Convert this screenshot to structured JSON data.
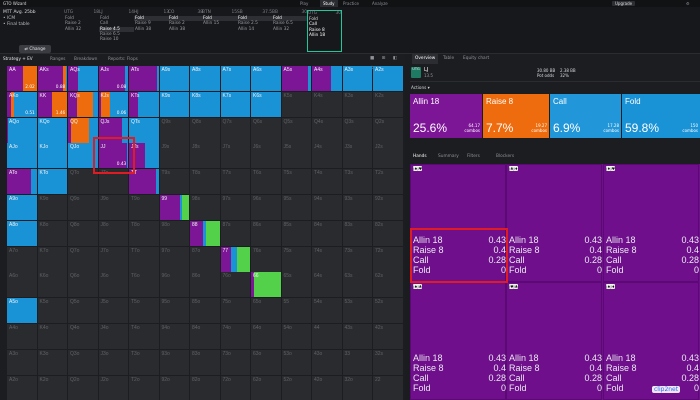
{
  "topnav": {
    "brand": "GTO Wizard",
    "items": [
      "Play",
      "Study",
      "Practice",
      "Analyze"
    ],
    "active": 1,
    "upgrade": "Upgrade"
  },
  "game": {
    "format": "MTT  Avg. 25bb",
    "line1": "ICM",
    "line2": "Final table",
    "change": "Change"
  },
  "positions": [
    {
      "name": "UTG",
      "stack": "18",
      "actions": [
        "Fold",
        "Raise 2",
        "Allin 32"
      ],
      "selected": -1
    },
    {
      "name": "LJ",
      "stack": "14",
      "actions": [
        "Fold",
        "Call",
        "Raise 4.5",
        "Raise 6.5",
        "Raise 10"
      ],
      "selected": 2
    },
    {
      "name": "HJ",
      "stack": "13",
      "actions": [
        "Fold",
        "Raise 9",
        "Allin 38"
      ],
      "selected": 0
    },
    {
      "name": "CO",
      "stack": "38",
      "actions": [
        "Fold",
        "Raise 2",
        "Allin 38"
      ],
      "selected": 0
    },
    {
      "name": "BTN",
      "stack": "15",
      "actions": [
        "Fold",
        "Allin 15"
      ],
      "selected": 0
    },
    {
      "name": "SB",
      "stack": "37.5",
      "actions": [
        "Fold",
        "Raise 2.5",
        "Allin 14"
      ],
      "selected": 0
    },
    {
      "name": "BB",
      "stack": "30",
      "actions": [
        "Fold",
        "Raise 6.5",
        "Allin 32"
      ],
      "selected": 0
    },
    {
      "name": "UTG",
      "stack": "30",
      "actions": [
        "Fold",
        "Call",
        "Raise 8",
        "Allin 18"
      ],
      "selected": -1,
      "current": true
    }
  ],
  "left_tabs": [
    "Strategy + EV",
    "Ranges",
    "Breakdown",
    "Reports: Flops"
  ],
  "left_tab_icons": "■ ⊞ ◧ ⚙",
  "right_tabs": [
    "Overview",
    "Table",
    "Equity chart"
  ],
  "summary": {
    "badge": "UTG",
    "label": "LJ",
    "sub": "13.5",
    "stats": [
      {
        "a": "30.80 BB",
        "b": "Pot odds"
      },
      {
        "a": "2.38 BB",
        "b": "32%"
      }
    ]
  },
  "actions_label": "Actions",
  "actions": [
    {
      "name": "Allin 18",
      "pct": "25.6%",
      "combos": "64.17",
      "combos_label": "combos",
      "color": "#7d1597"
    },
    {
      "name": "Raise 8",
      "pct": "7.7%",
      "combos": "19.27",
      "combos_label": "combos",
      "color": "#ee6c0d"
    },
    {
      "name": "Call",
      "pct": "6.9%",
      "combos": "17.28",
      "combos_label": "combos",
      "color": "#2196d8"
    },
    {
      "name": "Fold",
      "pct": "59.8%",
      "combos": "150",
      "combos_label": "combos",
      "color": "#1a92d6"
    }
  ],
  "hand_tabs": [
    "Hands",
    "Summary",
    "Filters",
    "Blockers"
  ],
  "hand_details": [
    {
      "cards": "J♠J♥",
      "rows": [
        {
          "n": "Allin 18",
          "v": "0.43"
        },
        {
          "n": "Raise 8",
          "v": "0.4"
        },
        {
          "n": "Call",
          "v": "0.28"
        },
        {
          "n": "Fold",
          "v": "0"
        }
      ]
    },
    {
      "cards": "J♣J♦",
      "rows": [
        {
          "n": "Allin 18",
          "v": "0.43"
        },
        {
          "n": "Raise 8",
          "v": "0.4"
        },
        {
          "n": "Call",
          "v": "0.28"
        },
        {
          "n": "Fold",
          "v": "0"
        }
      ]
    },
    {
      "cards": "J♦J♥",
      "rows": [
        {
          "n": "Allin 18",
          "v": "0.43"
        },
        {
          "n": "Raise 8",
          "v": "0.4"
        },
        {
          "n": "Call",
          "v": "0.28"
        },
        {
          "n": "Fold",
          "v": "0"
        }
      ]
    },
    {
      "cards": "J♠J♣",
      "rows": [
        {
          "n": "Allin 18",
          "v": "0.43"
        },
        {
          "n": "Raise 8",
          "v": "0.4"
        },
        {
          "n": "Call",
          "v": "0.28"
        },
        {
          "n": "Fold",
          "v": "0"
        }
      ]
    },
    {
      "cards": "J♥J♣",
      "rows": [
        {
          "n": "Allin 18",
          "v": "0.43"
        },
        {
          "n": "Raise 8",
          "v": "0.4"
        },
        {
          "n": "Call",
          "v": "0.28"
        },
        {
          "n": "Fold",
          "v": "0"
        }
      ]
    },
    {
      "cards": "J♠J♦",
      "rows": [
        {
          "n": "Allin 18",
          "v": "0.43"
        },
        {
          "n": "Raise 8",
          "v": "0.4"
        },
        {
          "n": "Call",
          "v": "0.28"
        },
        {
          "n": "Fold",
          "v": "0"
        }
      ]
    }
  ],
  "colors": {
    "allin": "#7d1597",
    "raise": "#ee6c0d",
    "call": "#1a92d6",
    "fold": "#53d14a",
    "empty": "#2a2b2e",
    "highlight": "#e11b23"
  },
  "matrix": {
    "ranks": [
      "A",
      "K",
      "Q",
      "J",
      "T",
      "9",
      "8",
      "7",
      "6",
      "5",
      "4",
      "3",
      "2"
    ],
    "shown_values": {
      "AA": "2.02",
      "AKs": "0.88",
      "AKo": "0.51",
      "KK": "1.46",
      "AJs": "0.08",
      "KJs": "0.06",
      "JJ": "0.43"
    },
    "mix": {
      "AA": [
        0.55,
        0.45,
        0,
        0
      ],
      "AKs": [
        0.85,
        0.1,
        0.05,
        0
      ],
      "AQs": [
        0.35,
        0,
        0.65,
        0
      ],
      "AJs": [
        0.9,
        0,
        0.1,
        0
      ],
      "ATs": [
        0.95,
        0,
        0.05,
        0
      ],
      "A9s": [
        0,
        0,
        1,
        0
      ],
      "A8s": [
        0,
        0,
        1,
        0
      ],
      "A7s": [
        0,
        0,
        1,
        0
      ],
      "A6s": [
        0,
        0,
        1,
        0
      ],
      "A5s": [
        0.88,
        0,
        0.12,
        0
      ],
      "A4s": [
        0.65,
        0,
        0.35,
        0
      ],
      "A3s": [
        0,
        0,
        1,
        0
      ],
      "A2s": [
        0,
        0,
        1,
        0
      ],
      "AKo": [
        0.15,
        0.1,
        0.75,
        0
      ],
      "KK": [
        0.5,
        0.5,
        0,
        0
      ],
      "KQs": [
        0.3,
        0.55,
        0.15,
        0
      ],
      "KJs": [
        0.1,
        0.3,
        0.6,
        0
      ],
      "KTs": [
        0.3,
        0,
        0.7,
        0
      ],
      "K9s": [
        0,
        0,
        1,
        0
      ],
      "K8s": [
        0,
        0,
        1,
        0
      ],
      "K7s": [
        0,
        0,
        1,
        0
      ],
      "K6s": [
        0,
        0,
        1,
        0
      ],
      "AQo": [
        0.05,
        0,
        0.95,
        0
      ],
      "KQo": [
        0,
        0,
        1,
        0
      ],
      "QQ": [
        0.1,
        0.6,
        0.3,
        0
      ],
      "QJs": [
        0.8,
        0,
        0.2,
        0
      ],
      "QTs": [
        0,
        0,
        1,
        0
      ],
      "AJo": [
        0,
        0,
        1,
        0
      ],
      "KJo": [
        0,
        0,
        1,
        0
      ],
      "QJo": [
        0,
        0,
        1,
        0
      ],
      "JJ": [
        0.95,
        0,
        0.05,
        0
      ],
      "JTs": [
        0.55,
        0,
        0.45,
        0
      ],
      "ATo": [
        0.8,
        0,
        0.2,
        0
      ],
      "KTo": [
        0,
        0,
        1,
        0
      ],
      "TT": [
        0.92,
        0,
        0.08,
        0
      ],
      "A9o": [
        0,
        0,
        1,
        0
      ],
      "99": [
        0.7,
        0,
        0.05,
        0.25
      ],
      "A8o": [
        0,
        0,
        1,
        0
      ],
      "88": [
        0.45,
        0,
        0.1,
        0.45
      ],
      "77": [
        0.35,
        0,
        0.2,
        0.45
      ],
      "66": [
        0.1,
        0,
        0,
        0.9
      ],
      "A5o": [
        0,
        0,
        1,
        0
      ]
    }
  }
}
